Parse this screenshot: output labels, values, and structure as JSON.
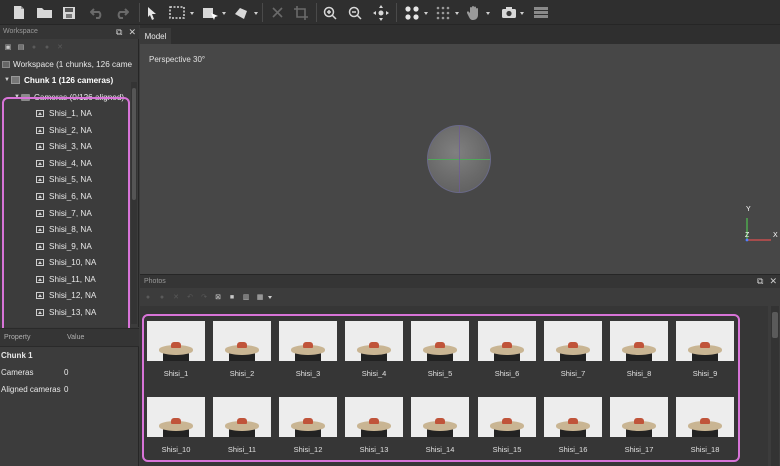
{
  "toolbar": {
    "icons": [
      "new-document-icon",
      "open-folder-icon",
      "save-icon",
      "undo-icon",
      "redo-icon",
      "navigation-cursor-icon",
      "rectangle-selection-icon",
      "transform-object-icon",
      "shape-drawing-icon",
      "delete-selection-icon",
      "crop-selection-icon",
      "zoom-in-icon",
      "zoom-out-icon",
      "move-object-icon",
      "points-view-icon",
      "grid-view-icon",
      "hand-view-icon",
      "capture-view-icon",
      "layers-icon"
    ]
  },
  "workspace": {
    "title": "Workspace",
    "root": "Workspace (1 chunks, 126 came",
    "chunk": "Chunk 1 (126 cameras)",
    "cameras_group": "Cameras (0/126 aligned)",
    "cameras": [
      "Shisi_1, NA",
      "Shisi_2, NA",
      "Shisi_3, NA",
      "Shisi_4, NA",
      "Shisi_5, NA",
      "Shisi_6, NA",
      "Shisi_7, NA",
      "Shisi_8, NA",
      "Shisi_9, NA",
      "Shisi_10, NA",
      "Shisi_11, NA",
      "Shisi_12, NA",
      "Shisi_13, NA"
    ]
  },
  "properties": {
    "header_property": "Property",
    "header_value": "Value",
    "section": "Chunk 1",
    "rows": [
      {
        "name": "Cameras",
        "value": "0"
      },
      {
        "name": "Aligned cameras",
        "value": "0"
      }
    ]
  },
  "model": {
    "tab": "Model",
    "view_label": "Perspective 30°",
    "axis_y": "Y",
    "axis_z": "Z",
    "axis_x": "X"
  },
  "photos": {
    "title": "Photos",
    "items": [
      "Shisi_1",
      "Shisi_2",
      "Shisi_3",
      "Shisi_4",
      "Shisi_5",
      "Shisi_6",
      "Shisi_7",
      "Shisi_8",
      "Shisi_9",
      "Shisi_10",
      "Shisi_11",
      "Shisi_12",
      "Shisi_13",
      "Shisi_14",
      "Shisi_15",
      "Shisi_16",
      "Shisi_17",
      "Shisi_18"
    ]
  },
  "colors": {
    "highlight": "#d874d8",
    "panel_bg": "#3c3c3c",
    "viewport_bg": "#474747",
    "axis_x": "#e05050",
    "axis_y": "#50c050",
    "axis_z": "#5080ff"
  }
}
